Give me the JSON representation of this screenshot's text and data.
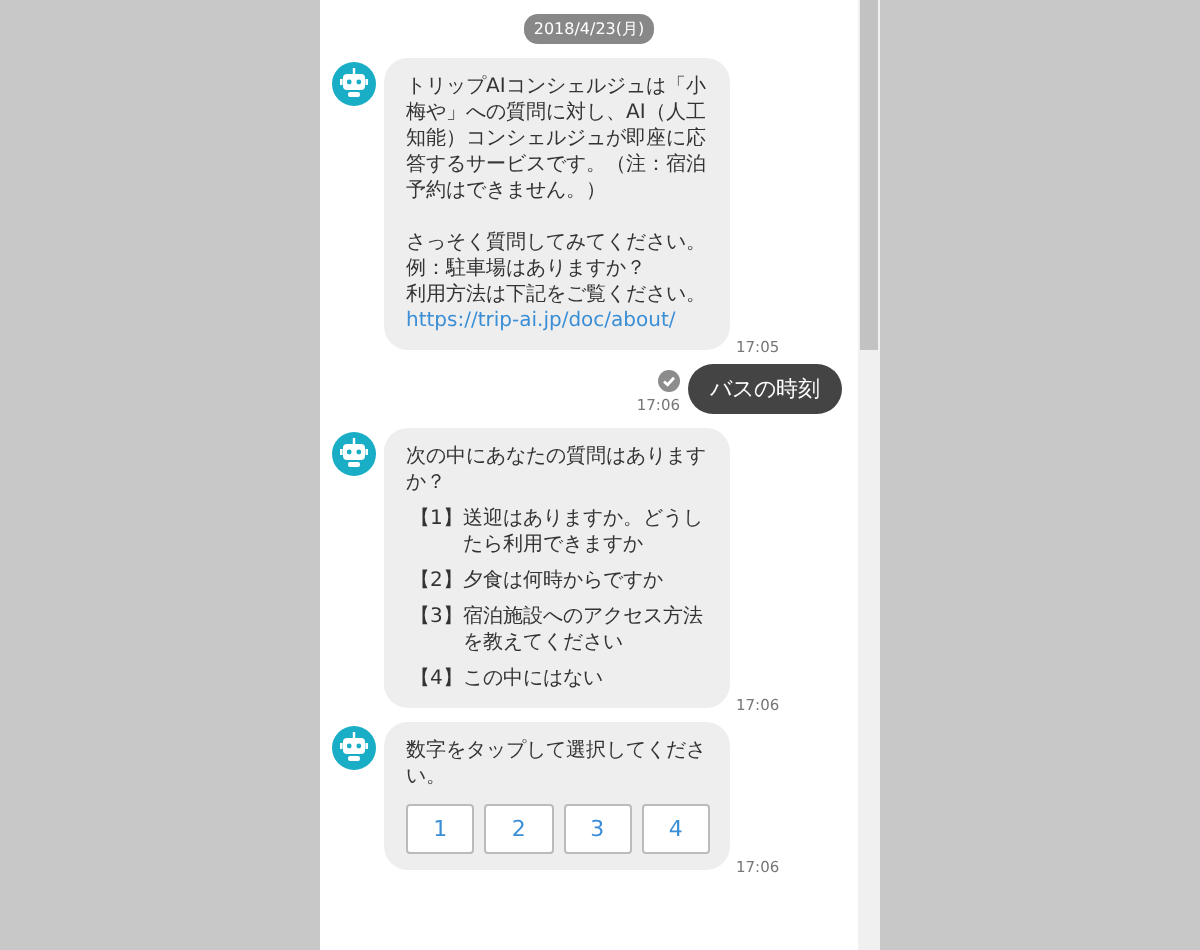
{
  "date": "2018/4/23(月)",
  "messages": [
    {
      "kind": "bot",
      "paragraphs": [
        [
          "トリップAIコンシェルジュは「小梅や」への質問に対し、AI（人工知能）コンシェルジュが即座に応答するサービスです。（注：宿泊予約はできません。）"
        ],
        [
          "さっそく質問してみてください。",
          "例：駐車場はありますか？",
          "利用方法は下記をご覧ください。"
        ]
      ],
      "link": "https://trip-ai.jp/doc/about/",
      "time": "17:05"
    },
    {
      "kind": "user",
      "text": "バスの時刻",
      "read": true,
      "time": "17:06"
    },
    {
      "kind": "bot",
      "text": "次の中にあなたの質問はありますか？",
      "options": [
        {
          "number": "【1】",
          "text": "送迎はありますか。どうしたら利用できますか"
        },
        {
          "number": "【2】",
          "text": "夕食は何時からですか"
        },
        {
          "number": "【3】",
          "text": "宿泊施設へのアクセス方法を教えてください"
        },
        {
          "number": "【4】",
          "text": "この中にはない"
        }
      ],
      "time": "17:06"
    },
    {
      "kind": "bot",
      "text": "数字をタップして選択してください。",
      "buttons": [
        "1",
        "2",
        "3",
        "4"
      ],
      "time": "17:06"
    }
  ]
}
